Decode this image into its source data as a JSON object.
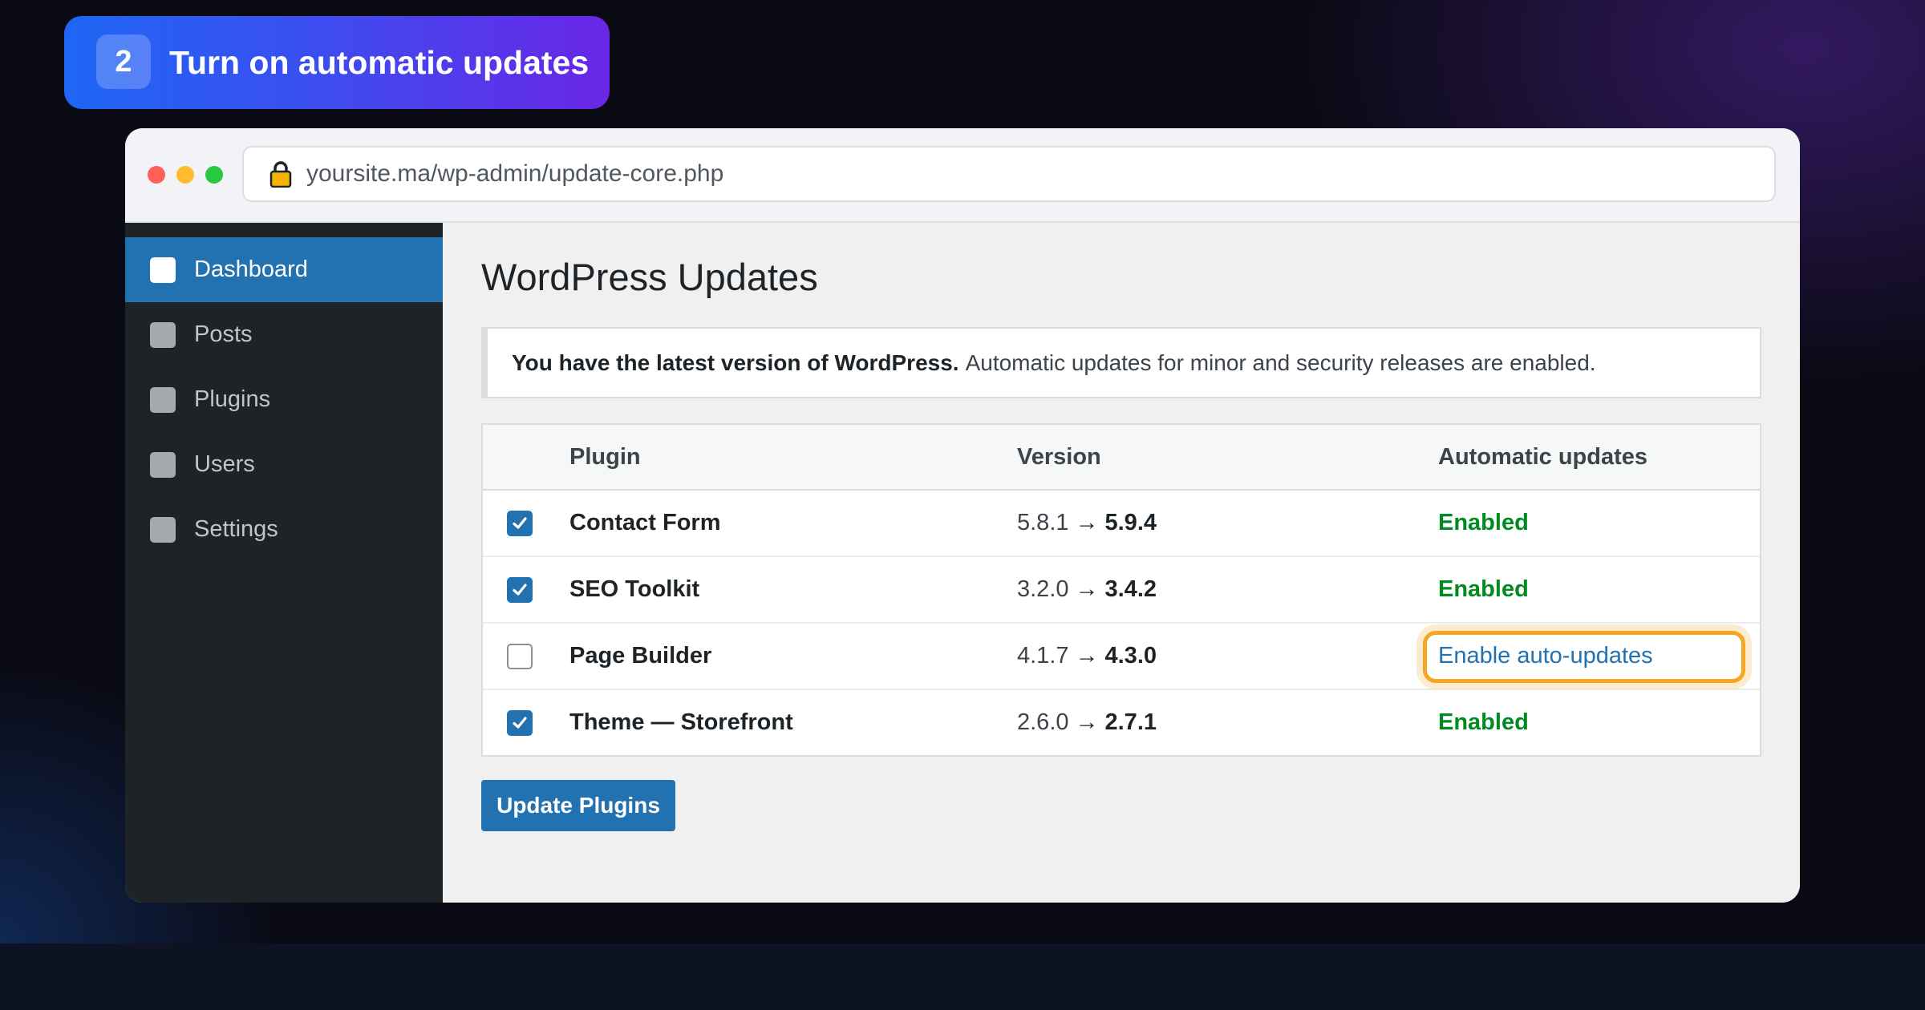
{
  "step": {
    "number": "2",
    "title": "Turn on automatic updates"
  },
  "browser": {
    "url": "yoursite.ma/wp-admin/update-core.php",
    "lock_icon": "lock-icon"
  },
  "sidebar": {
    "items": [
      {
        "label": "Dashboard",
        "active": true
      },
      {
        "label": "Posts",
        "active": false
      },
      {
        "label": "Plugins",
        "active": false
      },
      {
        "label": "Users",
        "active": false
      },
      {
        "label": "Settings",
        "active": false
      }
    ]
  },
  "page": {
    "title": "WordPress Updates",
    "notice_bold": "You have the latest version of WordPress.",
    "notice_text": "Automatic updates for minor and security releases are enabled."
  },
  "table": {
    "headers": {
      "plugin": "Plugin",
      "version": "Version",
      "auto": "Automatic updates"
    },
    "rows": [
      {
        "checked": true,
        "name": "Contact Form",
        "from": "5.8.1",
        "to": "5.9.4",
        "auto": "Enabled"
      },
      {
        "checked": true,
        "name": "SEO Toolkit",
        "from": "3.2.0",
        "to": "3.4.2",
        "auto": "Enabled"
      },
      {
        "checked": false,
        "name": "Page Builder",
        "from": "4.1.7",
        "to": "4.3.0",
        "auto": "Enable auto-updates"
      },
      {
        "checked": true,
        "name": "Theme — Storefront",
        "from": "2.6.0",
        "to": "2.7.1",
        "auto": "Enabled"
      }
    ],
    "arrow": "→"
  },
  "update_button": "Update Plugins",
  "colors": {
    "accent": "#2271b1",
    "enabled": "#008a20",
    "highlight": "#f5a623",
    "sidebar_bg": "#1d2327"
  }
}
